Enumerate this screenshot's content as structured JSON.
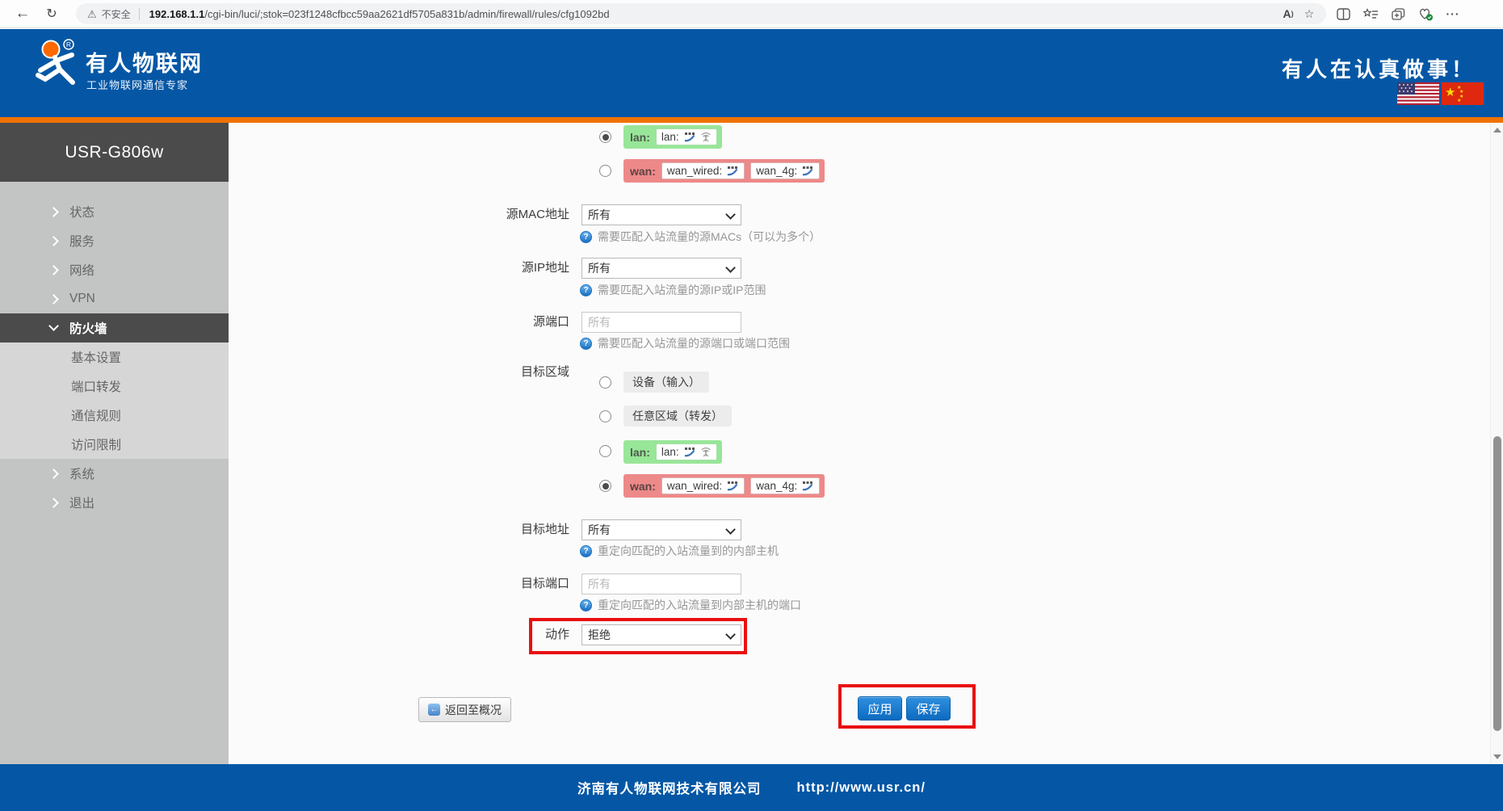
{
  "browser": {
    "security_label": "不安全",
    "url_host": "192.168.1.1",
    "url_path": "/cgi-bin/luci/;stok=023f1248cfbcc59aa2621df5705a831b/admin/firewall/rules/cfg1092bd"
  },
  "icons": {
    "back": "←",
    "reload": "↻",
    "warning": "⚠",
    "read_aloud": "A",
    "read_aloud_wave": ")",
    "star": "☆",
    "more": "···",
    "help": "?",
    "back_overview_arrow": "←"
  },
  "header": {
    "brand_title": "有人物联网",
    "brand_subtitle": "工业物联网通信专家",
    "slogan": "有人在认真做事！"
  },
  "sidebar": {
    "device_name": "USR-G806w",
    "items": [
      {
        "label": "状态"
      },
      {
        "label": "服务"
      },
      {
        "label": "网络"
      },
      {
        "label": "VPN"
      },
      {
        "label": "防火墙"
      },
      {
        "label": "基本设置"
      },
      {
        "label": "端口转发"
      },
      {
        "label": "通信规则"
      },
      {
        "label": "访问限制"
      },
      {
        "label": "系统"
      },
      {
        "label": "退出"
      }
    ]
  },
  "zones": {
    "lan_tag": "lan:",
    "lan_network": "lan:",
    "wan_tag": "wan:",
    "wan_network_wired": "wan_wired:",
    "wan_network_4g": "wan_4g:"
  },
  "form": {
    "src_mac": {
      "label": "源MAC地址",
      "value": "所有",
      "help": "需要匹配入站流量的源MACs（可以为多个）"
    },
    "src_ip": {
      "label": "源IP地址",
      "value": "所有",
      "help": "需要匹配入站流量的源IP或IP范围"
    },
    "src_port": {
      "label": "源端口",
      "placeholder": "所有",
      "help": "需要匹配入站流量的源端口或端口范围"
    },
    "dest_zone": {
      "label": "目标区域",
      "option_device": "设备（输入）",
      "option_any": "任意区域（转发）"
    },
    "dest_ip": {
      "label": "目标地址",
      "value": "所有",
      "help": "重定向匹配的入站流量到的内部主机"
    },
    "dest_port": {
      "label": "目标端口",
      "placeholder": "所有",
      "help": "重定向匹配的入站流量到内部主机的端口"
    },
    "action": {
      "label": "动作",
      "value": "拒绝"
    }
  },
  "buttons": {
    "back_overview": "返回至概况",
    "apply": "应用",
    "save": "保存"
  },
  "footer": {
    "company": "济南有人物联网技术有限公司",
    "website": "http://www.usr.cn/"
  },
  "colors": {
    "header_blue": "#0557a5",
    "orange_bar": "#f07203",
    "annotation_red": "#e91010",
    "zone_green": "#98e698",
    "zone_red": "#ed8989",
    "button_blue": "#0c6bbf"
  }
}
